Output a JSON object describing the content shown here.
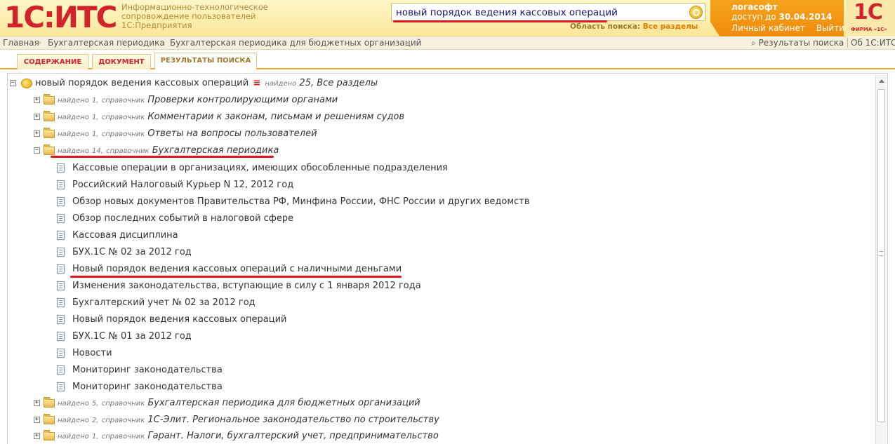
{
  "header": {
    "logo": "1С:ИТС",
    "tagline": [
      "Информационно-технологическое",
      "сопровождение пользователей",
      "1С:Предприятия"
    ],
    "search_value": "новый порядок ведения кассовых операций",
    "search_area_label": "Область поиска:",
    "search_area_value": "Все разделы",
    "user_name": "логасофт",
    "access_label": "доступ до",
    "access_date": "30.04.2014",
    "cabinet_link": "Личный кабинет",
    "logout_link": "Выйти",
    "brand_logo": "1С",
    "brand_text": "ФИРМА «1С»"
  },
  "breadcrumbs": [
    "Главная",
    "Бухгалтерская периодика",
    "Бухгалтерская периодика для бюджетных организаций"
  ],
  "top_links": {
    "results": "Результаты поиска",
    "about": "Об 1С:ИТС"
  },
  "tabs": [
    "СОДЕРЖАНИЕ",
    "ДОКУМЕНТ",
    "РЕЗУЛЬТАТЫ ПОИСКА"
  ],
  "tree": {
    "root": {
      "query": "новый порядок ведения кассовых операций",
      "marker": "≡",
      "found_label": "найдено",
      "count": "25,",
      "scope": "Все разделы"
    },
    "found_label": "найдено",
    "type_label": "справочник",
    "groups": [
      {
        "count": "1,",
        "name": "Проверки контролирующими органами",
        "toggle": "+"
      },
      {
        "count": "1,",
        "name": "Комментарии к законам, письмам и решениям судов",
        "toggle": "+"
      },
      {
        "count": "1,",
        "name": "Ответы на вопросы пользователей",
        "toggle": "+"
      },
      {
        "count": "14,",
        "name": "Бухгалтерская периодика",
        "toggle": "−"
      },
      {
        "count": "5,",
        "name": "Бухгалтерская периодика для бюджетных организаций",
        "toggle": "+"
      },
      {
        "count": "2,",
        "name": "1С-Элит. Региональное законодательство по строительству",
        "toggle": "+"
      },
      {
        "count": "1,",
        "name": "Гарант. Налоги, бухгалтерский учет, предпринимательство",
        "toggle": "+"
      }
    ],
    "documents": [
      "Кассовые операции в организациях, имеющих обособленные подразделения",
      "Российский Налоговый Курьер N 12, 2012 год",
      "Обзор новых документов Правительства РФ, Минфина России, ФНС России и других ведомств",
      "Обзор последних событий в налоговой сфере",
      "Кассовая дисциплина",
      "БУХ.1С № 02 за 2012 год",
      "Новый порядок ведения кассовых операций с наличными деньгами",
      "Изменения законодательства, вступающие в силу с 1 января 2012 года",
      "Бухгалтерский учет № 02 за 2012 год",
      "Новый порядок ведения кассовых операций",
      "БУХ.1С № 01 за 2012 год",
      "Новости",
      "Мониторинг законодательства",
      "Мониторинг законодательства"
    ]
  }
}
